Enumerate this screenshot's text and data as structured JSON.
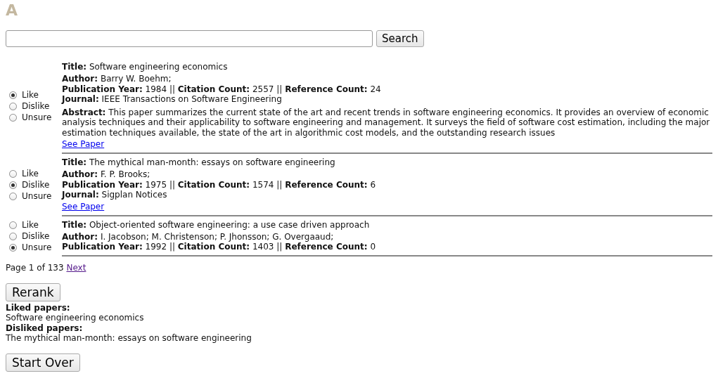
{
  "logo": "A",
  "search": {
    "button": "Search"
  },
  "papers": [
    {
      "rating": [
        {
          "label": "Like",
          "selected": true
        },
        {
          "label": "Dislike",
          "selected": false
        },
        {
          "label": "Unsure",
          "selected": false
        }
      ],
      "title": "**Title:** Software engineering economics",
      "lines": [
        "**Author:** Barry W. Boehm;",
        "**Publication Year:** 1984 || **Citation Count:** 2557 || **Reference Count:** 24",
        "**Journal:** IEEE Transactions on Software Engineering"
      ],
      "abstract": "**Abstract:** This paper summarizes the current state of the art and recent trends in software engineering economics. It provides an overview of economic analysis techniques and their applicability to software engineering and management. It surveys the field of software cost estimation, including the major estimation techniques available, the state of the art in algorithmic cost models, and the outstanding research issues",
      "link": "See Paper"
    },
    {
      "rating": [
        {
          "label": "Like",
          "selected": false
        },
        {
          "label": "Dislike",
          "selected": true
        },
        {
          "label": "Unsure",
          "selected": false
        }
      ],
      "title": "**Title:** The mythical man-month: essays on software engineering",
      "lines": [
        "**Author:** F. P. Brooks;",
        "**Publication Year:** 1975 || **Citation Count:** 1574 || **Reference Count:** 6",
        "**Journal:** Sigplan Notices"
      ],
      "link": "See Paper"
    },
    {
      "rating": [
        {
          "label": "Like",
          "selected": false
        },
        {
          "label": "Dislike",
          "selected": false
        },
        {
          "label": "Unsure",
          "selected": true
        }
      ],
      "title": "**Title:** Object-oriented software engineering: a use case driven approach",
      "lines": [
        "**Author:** I. Jacobson; M. Christenson; P. Jhonsson; G. Overgaaud;",
        "**Publication Year:** 1992 || **Citation Count:** 1403 || **Reference Count:** 0"
      ]
    }
  ],
  "pagination": {
    "text": "Page 1 of 133",
    "next": "Next"
  },
  "rerank_button": "Rerank",
  "summary": [
    {
      "heading": "Liked papers:",
      "items": [
        "Software engineering economics"
      ]
    },
    {
      "heading": "Disliked papers:",
      "items": [
        "The mythical man-month: essays on software engineering"
      ]
    }
  ],
  "start_over_button": "Start Over"
}
